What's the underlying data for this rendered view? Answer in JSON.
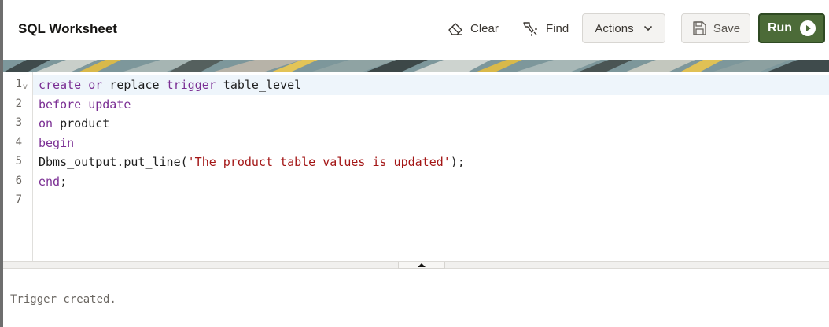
{
  "header": {
    "title": "SQL Worksheet",
    "clear_label": "Clear",
    "find_label": "Find",
    "actions_label": "Actions",
    "save_label": "Save",
    "run_label": "Run"
  },
  "editor": {
    "line_numbers": [
      "1",
      "2",
      "3",
      "4",
      "5",
      "6",
      "7"
    ],
    "active_line": 1
  },
  "output": {
    "message": "Trigger created."
  },
  "colors": {
    "run_button": "#4c6b38",
    "keyword": "#7b2f94",
    "string": "#a31515",
    "active_line": "#eef5fb"
  },
  "icons": {
    "clear": "eraser-icon",
    "find": "flashlight-icon",
    "actions": "chevron-down-icon",
    "save": "floppy-disk-icon",
    "run": "play-icon"
  }
}
